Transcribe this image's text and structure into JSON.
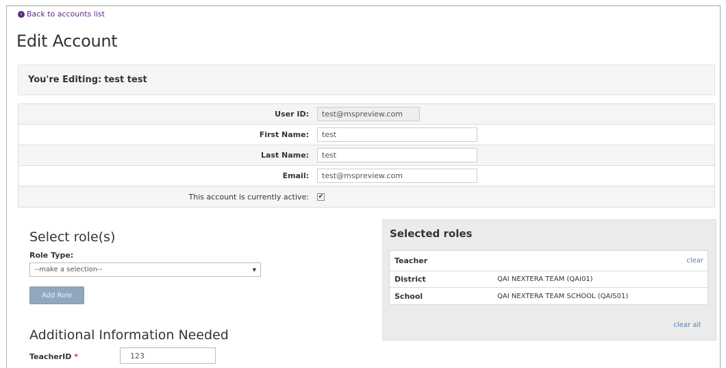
{
  "nav": {
    "back_label": "Back to accounts list"
  },
  "page": {
    "title": "Edit Account"
  },
  "editing": {
    "prefix": "You're Editing:",
    "name": "test test"
  },
  "account_form": {
    "user_id_label": "User ID:",
    "user_id_value": "test@mspreview.com",
    "first_name_label": "First Name:",
    "first_name_value": "test",
    "last_name_label": "Last Name:",
    "last_name_value": "test",
    "email_label": "Email:",
    "email_value": "test@mspreview.com",
    "active_label": "This account is currently active:",
    "active_checked": true
  },
  "select_roles": {
    "title": "Select role(s)",
    "role_type_label": "Role Type:",
    "role_type_selected": "--make a selection--",
    "add_role_label": "Add Role"
  },
  "additional_info": {
    "title": "Additional Information Needed",
    "teacher_id_label": "TeacherID",
    "required_marker": "*",
    "teacher_id_value": "123"
  },
  "selected_roles": {
    "title": "Selected roles",
    "role_name": "Teacher",
    "clear_label": "clear",
    "rows": [
      {
        "key": "District",
        "value": "QAI NEXTERA TEAM (QAI01)"
      },
      {
        "key": "School",
        "value": "QAI NEXTERA TEAM SCHOOL (QAIS01)"
      }
    ],
    "clear_all_label": "clear all"
  },
  "colors": {
    "link_purple": "#5b2a86",
    "link_blue": "#5a7ea8",
    "button_disabled": "#8fa8be",
    "required_red": "#c0392b"
  }
}
